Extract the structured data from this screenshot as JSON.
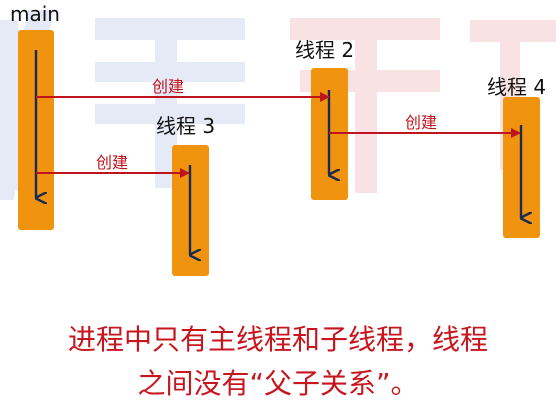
{
  "threads": {
    "main": "main",
    "t2": "线程 2",
    "t3": "线程 3",
    "t4": "线程 4"
  },
  "edges": {
    "main_to_t2": "创建",
    "main_to_t3": "创建",
    "t2_to_t4": "创建"
  },
  "caption": {
    "line1": "进程中只有主线程和子线程，线程",
    "line2": "之间没有“父子关系”。"
  },
  "colors": {
    "bar": "#f0930e",
    "bar_arrow": "#1a2a52",
    "edge": "#c0141c",
    "caption": "#c8161e"
  }
}
